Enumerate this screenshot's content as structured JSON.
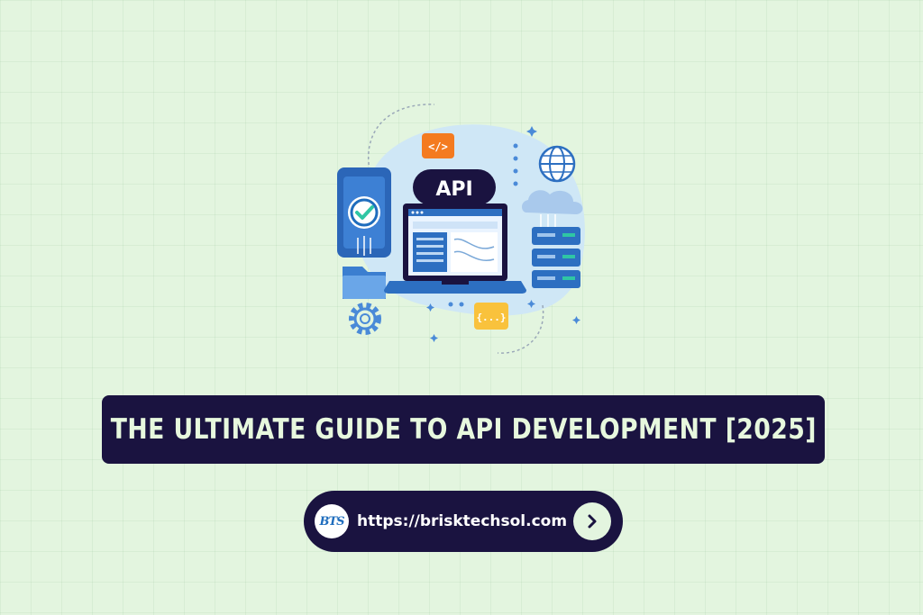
{
  "illustration": {
    "api_label": "API",
    "code_tag": "</>",
    "braces_label": "{...}"
  },
  "banner": {
    "title": "THE ULTIMATE GUIDE TO API DEVELOPMENT [2025]"
  },
  "link": {
    "logo_text": "BTS",
    "url": "https://brisktechsol.com"
  },
  "colors": {
    "background": "#e3f5df",
    "banner_bg": "#1a1340",
    "banner_text": "#e7f8de",
    "accent_blue": "#1f6dbd",
    "accent_orange": "#f47b20",
    "accent_yellow": "#f9c23c"
  }
}
